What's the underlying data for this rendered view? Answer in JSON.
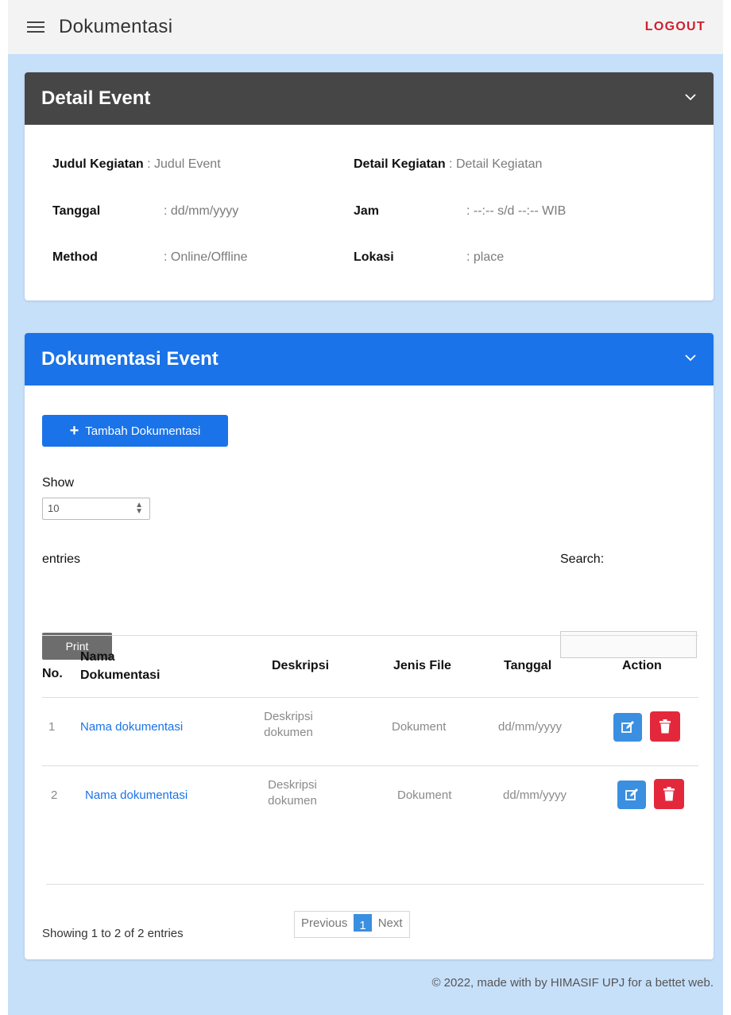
{
  "topbar": {
    "title": "Dokumentasi",
    "logout_label": "LOGOUT"
  },
  "detail_card": {
    "title": "Detail Event",
    "fields": {
      "judul": {
        "label": "Judul Kegiatan",
        "value": ": Judul Event"
      },
      "detail": {
        "label": "Detail Kegiatan",
        "value": ": Detail Kegiatan"
      },
      "tanggal": {
        "label": "Tanggal",
        "value": ": dd/mm/yyyy"
      },
      "jam": {
        "label": "Jam",
        "value": ": --:-- s/d --:-- WIB"
      },
      "method": {
        "label": "Method",
        "value": ": Online/Offline"
      },
      "lokasi": {
        "label": "Lokasi",
        "value": ": place"
      }
    }
  },
  "doc_card": {
    "title": "Dokumentasi Event",
    "add_button_label": "Tambah Dokumentasi",
    "show_label": "Show",
    "show_value": "10",
    "entries_label": "entries",
    "print_label": "Print",
    "search_label": "Search:",
    "search_value": "",
    "table": {
      "headers": {
        "no": "No.",
        "nama_line1": "Nama",
        "nama_line2": "Dokumentasi",
        "deskripsi": "Deskripsi",
        "jenis": "Jenis File",
        "tanggal": "Tanggal",
        "action": "Action"
      },
      "rows": [
        {
          "no": "1",
          "nama": "Nama dokumentasi",
          "desk_line1": "Deskripsi",
          "desk_line2": "dokumen",
          "jenis": "Dokument",
          "tanggal": "dd/mm/yyyy"
        },
        {
          "no": "2",
          "nama": "Nama dokumentasi",
          "desk_line1": "Deskripsi",
          "desk_line2": "dokumen",
          "jenis": "Dokument",
          "tanggal": "dd/mm/yyyy"
        }
      ]
    },
    "showing_text": "Showing 1 to 2 of 2 entries",
    "pagination": {
      "previous": "Previous",
      "current_page": "1",
      "next": "Next"
    }
  },
  "footer": {
    "text": "© 2022, made with by HIMASIF UPJ for a bettet web."
  },
  "colors": {
    "primary": "#1a73e8",
    "danger": "#e4283c",
    "dark_header": "#464646",
    "background": "#c7e0fa",
    "logout": "#d02030"
  },
  "icons": [
    "menu-icon",
    "chevron-down-icon",
    "plus-icon",
    "edit-icon",
    "trash-icon",
    "select-arrows-icon"
  ]
}
